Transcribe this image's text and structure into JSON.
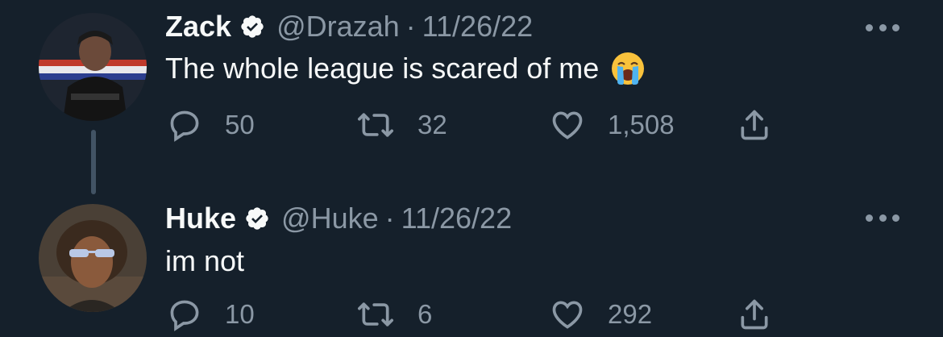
{
  "tweets": [
    {
      "name": "Zack",
      "handle": "@Drazah",
      "separator": "·",
      "date": "11/26/22",
      "text": "The whole league is scared of me",
      "emoji": "loudly-crying-face",
      "replies": "50",
      "retweets": "32",
      "likes": "1,508",
      "avatar_colors": {
        "bg": "#1e2530",
        "stripe_red": "#c0392b",
        "stripe_white": "#e8e8ec",
        "stripe_blue": "#2c3e8f"
      }
    },
    {
      "name": "Huke",
      "handle": "@Huke",
      "separator": "·",
      "date": "11/26/22",
      "text": "im not",
      "replies": "10",
      "retweets": "6",
      "likes": "292",
      "avatar_colors": {
        "bg": "#4a4036",
        "skin": "#8a5a3c",
        "hair": "#3a2a1e",
        "glasses": "#b9c8e6"
      }
    }
  ],
  "icons": {
    "verified": "verified-badge-icon",
    "reply": "reply-icon",
    "retweet": "retweet-icon",
    "like": "heart-icon",
    "share": "share-icon",
    "more": "more-icon"
  },
  "colors": {
    "background": "#15202b",
    "text": "#f7f9f9",
    "secondary": "#8b98a5",
    "thread_line": "#425364"
  }
}
